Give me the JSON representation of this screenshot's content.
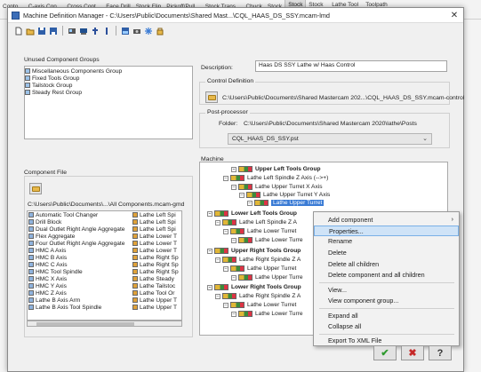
{
  "background": {
    "tabs": [
      "Conto...",
      "C-axis Con...",
      "Cross Cont...",
      "Face Drill",
      "Stock Flip",
      "Pickoff/Pull...",
      "Stock Trans...",
      "Chuck",
      "Stock",
      "Stock Display",
      "Stock Model",
      "Lathe Tool Manager",
      "Toolpath Transform"
    ]
  },
  "dialog": {
    "title": "Machine Definition Manager - C:\\Users\\Public\\Documents\\Shared Mast...\\CQL_HAAS_DS_SSY.mcam-lmd",
    "close_label": "✕"
  },
  "toolbar": {
    "icons": [
      "new-icon",
      "open-icon",
      "save-icon",
      "save-as-icon",
      "machine-icon",
      "control-icon",
      "pin-icon",
      "info-icon",
      "group-icon",
      "camera-icon",
      "star-icon",
      "lock-icon"
    ]
  },
  "unused_groups": {
    "label": "Unused Component Groups",
    "items": [
      "Miscellaneous Components Group",
      "Fixed Tools Group",
      "Tailstock Group",
      "Steady Rest Group"
    ]
  },
  "description": {
    "label": "Description:",
    "value": "Haas DS SSY Lathe w/ Haas Control"
  },
  "control_definition": {
    "label": "Control Definition",
    "path": "C:\\Users\\Public\\Documents\\Shared Mastercam 202...\\CQL_HAAS_DS_SSY.mcam-control"
  },
  "post_processor": {
    "label": "Post-processor",
    "folder_label": "Folder:",
    "folder": "C:\\Users\\Public\\Documents\\Shared Mastercam 2020\\lathe\\Posts",
    "selected": "CQL_HAAS_DS_SSY.pst"
  },
  "component_file": {
    "label": "Component File",
    "path": "C:\\Users\\Public\\Documents\\...\\All Components.mcam-gmd",
    "left_items": [
      "Automatic Tool Changer",
      "Drill Block",
      "Dual Outlet Right Angle Aggregate",
      "Flex Aggregate",
      "Four Outlet Right Angle Aggregate",
      "HMC A Axis",
      "HMC B Axis",
      "HMC C Axis",
      "HMC Tool Spindle",
      "HMC X Axis",
      "HMC Y Axis",
      "HMC Z Axis",
      "Lathe B Axis Arm",
      "Lathe B Axis Tool Spindle"
    ],
    "right_items": [
      "Lathe Left Spi",
      "Lathe Left Spi",
      "Lathe Left Spi",
      "Lathe Lower T",
      "Lathe Lower T",
      "Lathe Lower T",
      "Lathe Right Sp",
      "Lathe Right Sp",
      "Lathe Right Sp",
      "Lathe Steady",
      "Lathe Tailstoc",
      "Lathe Tool Or",
      "Lathe Upper T",
      "Lathe Upper T"
    ]
  },
  "machine": {
    "label": "Machine",
    "nodes": [
      {
        "text": "Upper Left Tools Group",
        "bold": true
      },
      {
        "text": "Lathe Left Spindle Z Axis (-->+)",
        "bold": false
      },
      {
        "text": "Lathe Upper Turret X Axis",
        "bold": false
      },
      {
        "text": "Lathe Upper Turret Y Axis",
        "bold": false
      },
      {
        "text": "Lathe Upper Turret",
        "bold": false,
        "selected": true
      },
      {
        "text": "Lower Left Tools Group",
        "bold": true
      },
      {
        "text": "Lathe Left Spindle Z A",
        "bold": false
      },
      {
        "text": "Lathe Lower Turret",
        "bold": false
      },
      {
        "text": "Lathe Lower Turre",
        "bold": false
      },
      {
        "text": "Upper Right Tools Group",
        "bold": true
      },
      {
        "text": "Lathe Right Spindle Z A",
        "bold": false
      },
      {
        "text": "Lathe Upper Turret",
        "bold": false
      },
      {
        "text": "Lathe Upper Turre",
        "bold": false
      },
      {
        "text": "Lower Right Tools Group",
        "bold": true
      },
      {
        "text": "Lathe Right Spindle Z A",
        "bold": false
      },
      {
        "text": "Lathe Lower Turret",
        "bold": false
      },
      {
        "text": "Lathe Lower Turre",
        "bold": false
      }
    ]
  },
  "context_menu": {
    "items": [
      "Add component",
      "Properties...",
      "Rename",
      "Delete",
      "Delete all children",
      "Delete component and all children",
      "View...",
      "View component group...",
      "Expand all",
      "Collapse all",
      "Export To XML File"
    ]
  },
  "buttons": {
    "ok": "✔",
    "cancel": "✖",
    "help": "?"
  },
  "colors": {
    "ok": "#2e9a2e",
    "cancel": "#c62828",
    "selection": "#3a7bd5",
    "menu_highlight": "#cfe3f7"
  }
}
